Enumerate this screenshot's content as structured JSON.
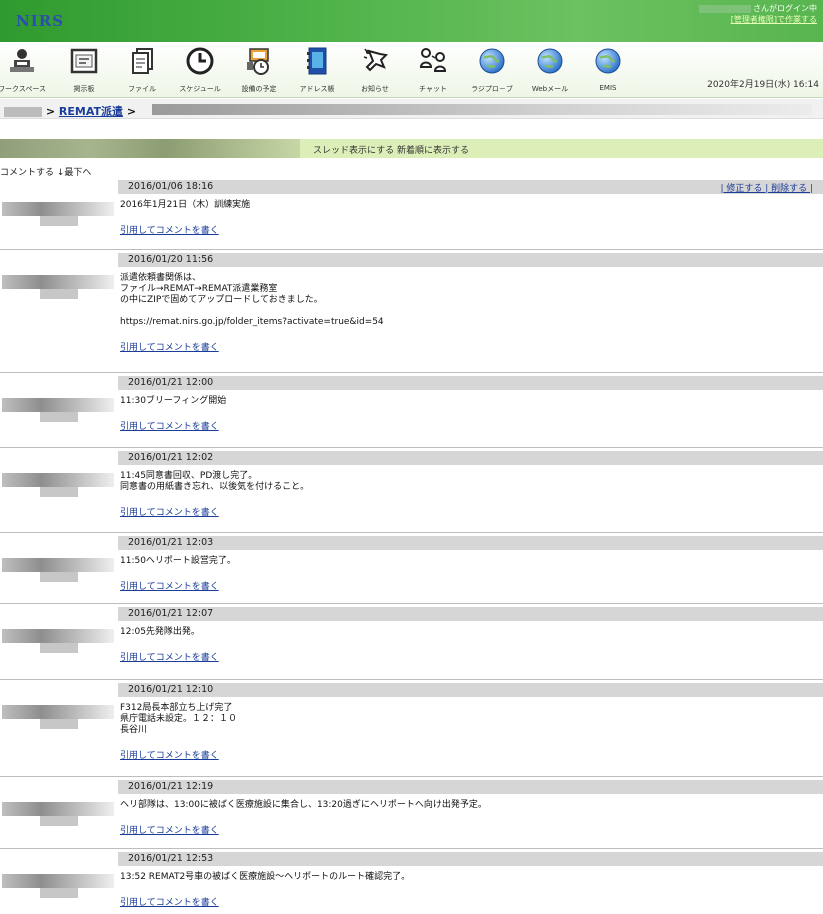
{
  "app": {
    "logo": "NIRS",
    "user_suffix": "さんがログイン中",
    "user_link": "[管理者権限]で作業する"
  },
  "toolbar": [
    {
      "label": "ワークスペース",
      "icon": "workspace-icon"
    },
    {
      "label": "掲示板",
      "icon": "board-icon"
    },
    {
      "label": "ファイル",
      "icon": "file-icon"
    },
    {
      "label": "スケジュール",
      "icon": "clock-icon"
    },
    {
      "label": "設備の予定",
      "icon": "equipment-icon"
    },
    {
      "label": "アドレス帳",
      "icon": "address-book-icon"
    },
    {
      "label": "お知らせ",
      "icon": "notice-icon"
    },
    {
      "label": "チャット",
      "icon": "chat-icon"
    },
    {
      "label": "ラジプロ－ブ",
      "icon": "globe-icon"
    },
    {
      "label": "Webメール",
      "icon": "globe-icon"
    },
    {
      "label": "EMIS",
      "icon": "globe-icon"
    }
  ],
  "current_date": "2020年2月19日(水) 16:14",
  "breadcrumb": {
    "sep1": " > ",
    "link": "REMAT派遣",
    "sep2": " >"
  },
  "threadbar": {
    "links": "スレッド表示にする 新着順に表示する"
  },
  "top_commands": "コメントする ↓最下へ",
  "comment_actions": "| 修正する | 削除する |",
  "quote_label": "引用してコメントを書く",
  "comments": [
    {
      "date": "2016/01/06 18:16",
      "lines": [
        "2016年1月21日（木）訓練実施"
      ]
    },
    {
      "date": "2016/01/20 11:56",
      "lines": [
        "派遣依頼書関係は、",
        "ファイル→REMAT→REMAT派遣業務室",
        "の中にZIPで固めてアップロードしておきました。",
        "",
        "https://remat.nirs.go.jp/folder_items?activate=true&id=54"
      ]
    },
    {
      "date": "2016/01/21 12:00",
      "lines": [
        "11:30ブリーフィング開始"
      ]
    },
    {
      "date": "2016/01/21 12:02",
      "lines": [
        "11:45同意書回収、PD渡し完了。",
        "同意書の用紙書き忘れ、以後気を付けること。"
      ]
    },
    {
      "date": "2016/01/21 12:03",
      "lines": [
        "11:50ヘリポート設営完了。"
      ]
    },
    {
      "date": "2016/01/21 12:07",
      "lines": [
        "12:05先発隊出発。"
      ]
    },
    {
      "date": "2016/01/21 12:10",
      "lines": [
        "F312局長本部立ち上げ完了",
        "県庁電話未設定。１２：１０",
        "長谷川"
      ]
    },
    {
      "date": "2016/01/21 12:19",
      "lines": [
        "ヘリ部隊は、13:00に被ばく医療施設に集合し、13:20過ぎにヘリポートへ向け出発予定。"
      ]
    },
    {
      "date": "2016/01/21 12:53",
      "lines": [
        "13:52 REMAT2号車の被ばく医療施設～ヘリポートのルート確認完了。"
      ]
    }
  ]
}
